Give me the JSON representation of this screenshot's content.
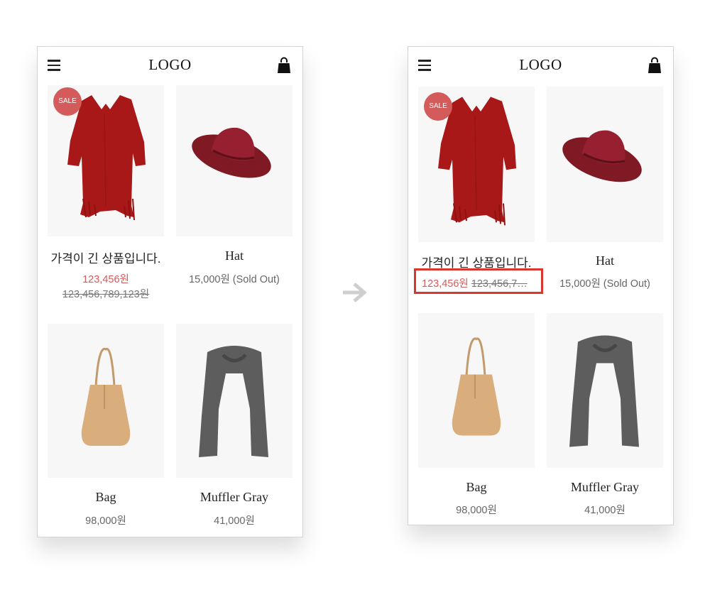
{
  "header": {
    "logo": "LOGO"
  },
  "products": [
    {
      "name": "가격이 긴 상품입니다.",
      "price": "123,456원",
      "original_price": "123,456,789,123원",
      "badge": "SALE"
    },
    {
      "name": "Hat",
      "price": "15,000원 (Sold Out)"
    },
    {
      "name": "Bag",
      "price": "98,000원"
    },
    {
      "name": "Muffler Gray",
      "price": "41,000원"
    }
  ],
  "after": {
    "original_price_truncated": "123,456,7…"
  },
  "icons": [
    "menu-icon",
    "shopping-bag-icon",
    "right-arrow-icon"
  ],
  "colors": {
    "sale": "#d65a5a",
    "highlight": "#d9362e",
    "image_bg": "#f7f7f7"
  }
}
